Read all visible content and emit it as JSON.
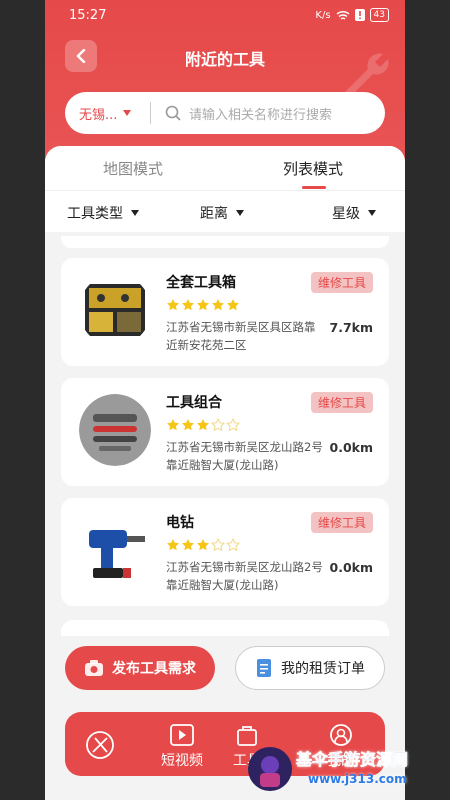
{
  "status": {
    "time": "15:27",
    "net": "K/s",
    "battery": "43"
  },
  "header": {
    "title": "附近的工具"
  },
  "search": {
    "city": "无锡...",
    "placeholder": "请输入相关名称进行搜索"
  },
  "tabs": [
    {
      "label": "地图模式"
    },
    {
      "label": "列表模式"
    }
  ],
  "filters": [
    {
      "label": "工具类型"
    },
    {
      "label": "距离"
    },
    {
      "label": "星级"
    }
  ],
  "items": [
    {
      "name": "全套工具箱",
      "tag": "维修工具",
      "stars": 5,
      "address": "江苏省无锡市新吴区具区路靠近新安花苑二区",
      "distance": "7.7km"
    },
    {
      "name": "工具组合",
      "tag": "维修工具",
      "stars": 3,
      "address": "江苏省无锡市新吴区龙山路2号靠近融智大厦(龙山路)",
      "distance": "0.0km"
    },
    {
      "name": "电钻",
      "tag": "维修工具",
      "stars": 3,
      "address": "江苏省无锡市新吴区龙山路2号靠近融智大厦(龙山路)",
      "distance": "0.0km"
    }
  ],
  "actions": {
    "publish": "发布工具需求",
    "orders": "我的租赁订单"
  },
  "nav": [
    {
      "label": ""
    },
    {
      "label": "短视频"
    },
    {
      "label": "工具"
    },
    {
      "label": "我的"
    }
  ],
  "watermark": {
    "title": "基伞手游资源网",
    "url": "www.j313.com"
  },
  "colors": {
    "brand": "#e64949",
    "star": "#f5c518",
    "tag_bg": "#f3c2c2"
  }
}
